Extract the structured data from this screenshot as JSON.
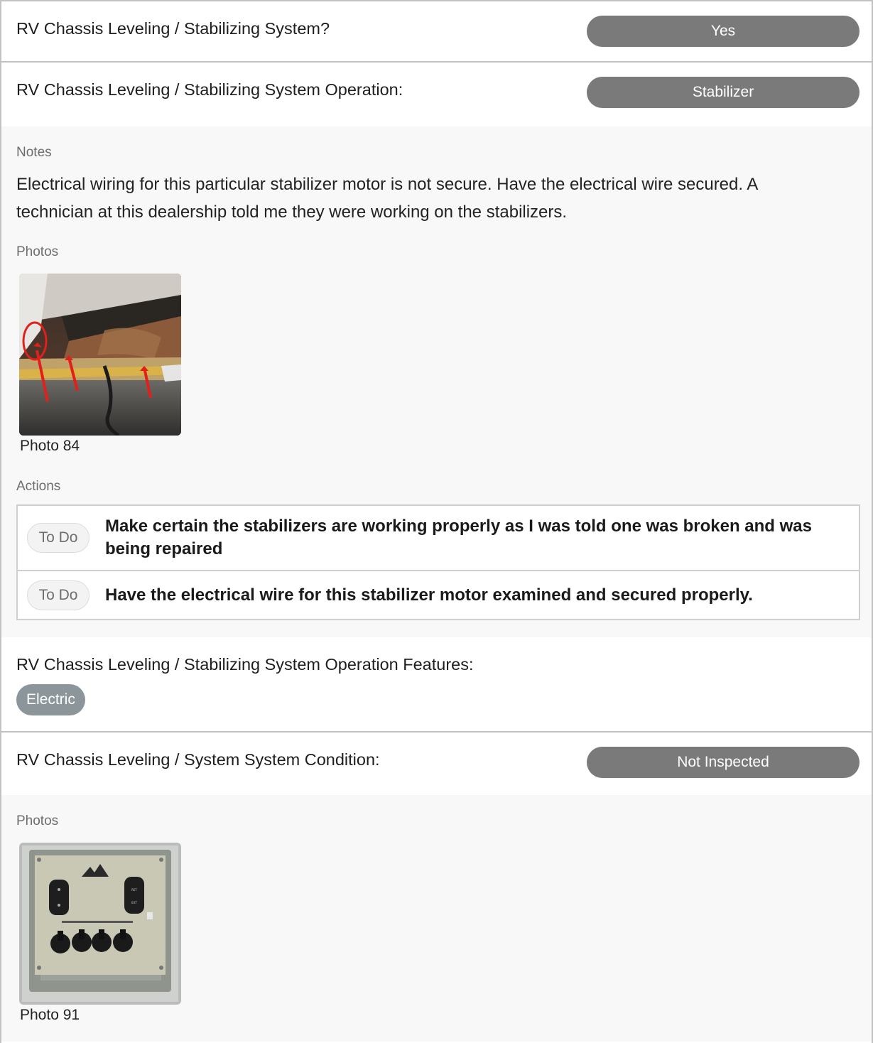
{
  "sections": [
    {
      "question": "RV Chassis Leveling / Stabilizing System?",
      "answer": "Yes"
    },
    {
      "question": "RV Chassis Leveling / Stabilizing System Operation:",
      "answer": "Stabilizer",
      "notes_label": "Notes",
      "notes": "Electrical wiring for this particular stabilizer motor is not secure. Have the electrical wire secured. A technician at this dealership told me they were working on the stabilizers.",
      "photos_label": "Photos",
      "photos": [
        {
          "caption": "Photo 84"
        }
      ],
      "actions_label": "Actions",
      "actions": [
        {
          "status": "To Do",
          "text": "Make certain the stabilizers are working properly as I was told one was broken and was being repaired"
        },
        {
          "status": "To Do",
          "text": "Have the electrical wire for this stabilizer motor examined and secured properly."
        }
      ]
    },
    {
      "question": "RV Chassis Leveling / Stabilizing System Operation Features:",
      "chips": [
        "Electric"
      ]
    },
    {
      "question": "RV Chassis Leveling / System System Condition:",
      "answer": "Not Inspected",
      "photos_label": "Photos",
      "photos": [
        {
          "caption": "Photo 91"
        }
      ]
    }
  ],
  "colors": {
    "answer_pill": "#7a7a7a",
    "chip": "#8c969a",
    "details_bg": "#f8f8f8",
    "divider": "#c2c2c2"
  }
}
